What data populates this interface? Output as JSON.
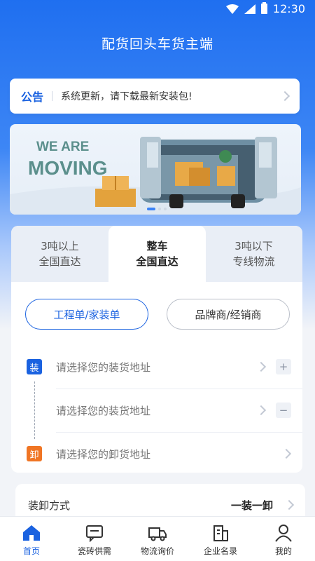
{
  "status_bar": {
    "time": "12:30"
  },
  "header": {
    "title": "配货回头车货主端"
  },
  "notice": {
    "tag": "公告",
    "text": "系统更新，请下载最新安装包!"
  },
  "banner": {
    "headline_line1": "WE ARE",
    "headline_line2": "MOVING"
  },
  "order": {
    "tabs": [
      {
        "line1": "3吨以上",
        "line2": "全国直达",
        "active": false
      },
      {
        "line1": "整车",
        "line2": "全国直达",
        "active": true
      },
      {
        "line1": "3吨以下",
        "line2": "专线物流",
        "active": false
      }
    ],
    "client_types": [
      "工程单/家装单",
      "品牌商/经销商"
    ],
    "load_badge": "装",
    "unload_badge": "卸",
    "load_placeholder_1": "请选择您的装货地址",
    "load_placeholder_2": "请选择您的装货地址",
    "unload_placeholder": "请选择您的卸货地址"
  },
  "method": {
    "label": "装卸方式",
    "value": "一装一卸"
  },
  "tabbar": [
    {
      "label": "首页",
      "icon": "home-icon",
      "active": true
    },
    {
      "label": "瓷砖供需",
      "icon": "chat-icon",
      "active": false
    },
    {
      "label": "物流询价",
      "icon": "truck-icon",
      "active": false
    },
    {
      "label": "企业名录",
      "icon": "building-icon",
      "active": false
    },
    {
      "label": "我的",
      "icon": "user-icon",
      "active": false
    }
  ],
  "colors": {
    "primary": "#1a62e0",
    "accent": "#f07524"
  }
}
